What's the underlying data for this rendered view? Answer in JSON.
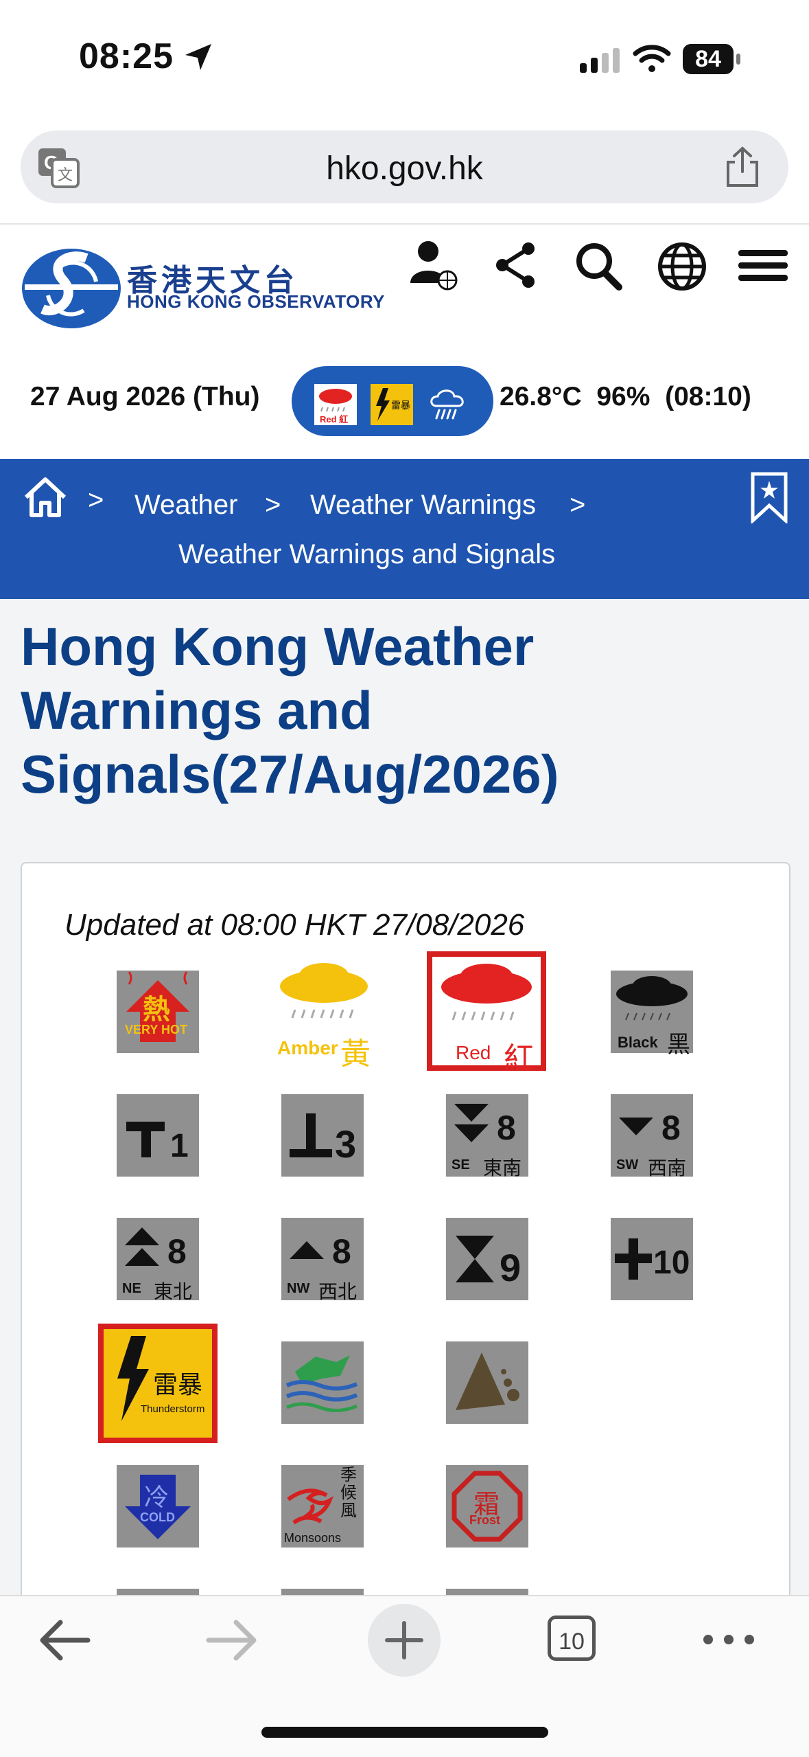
{
  "status_bar": {
    "time": "08:25",
    "battery": "84"
  },
  "browser": {
    "url": "hko.gov.hk",
    "tabs_count": "10"
  },
  "site": {
    "logo_zh": "香港天文台",
    "logo_en": "HONG KONG OBSERVATORY",
    "date": "27 Aug 2026 (Thu)",
    "temperature": "26.8°C",
    "humidity": "96%",
    "obs_time": "(08:10)"
  },
  "breadcrumb": {
    "sep": ">",
    "items": [
      "Weather",
      "Weather Warnings",
      "Weather Warnings and Signals"
    ]
  },
  "page": {
    "title": "Hong Kong Weather Warnings and Signals(27/Aug/2026)",
    "updated": "Updated at 08:00 HKT 27/08/2026"
  },
  "warnings": {
    "very_hot": {
      "zh": "熱",
      "en": "VERY HOT"
    },
    "amber": {
      "en": "Amber",
      "zh": "黃"
    },
    "red": {
      "en": "Red",
      "zh": "紅"
    },
    "black": {
      "en": "Black",
      "zh": "黑"
    },
    "t1": "1",
    "t3": "3",
    "t8se": {
      "num": "8",
      "dir": "SE",
      "zh": "東南"
    },
    "t8sw": {
      "num": "8",
      "dir": "SW",
      "zh": "西南"
    },
    "t8ne": {
      "num": "8",
      "dir": "NE",
      "zh": "東北"
    },
    "t8nw": {
      "num": "8",
      "dir": "NW",
      "zh": "西北"
    },
    "t9": "9",
    "t10": "10",
    "thunderstorm": {
      "zh": "雷暴",
      "en": "Thunderstorm"
    },
    "cold": {
      "zh": "冷",
      "en": "COLD"
    },
    "monsoon": {
      "zh": "季候風",
      "en": "Monsoons"
    },
    "frost": {
      "zh": "霜",
      "en": "Frost"
    }
  }
}
